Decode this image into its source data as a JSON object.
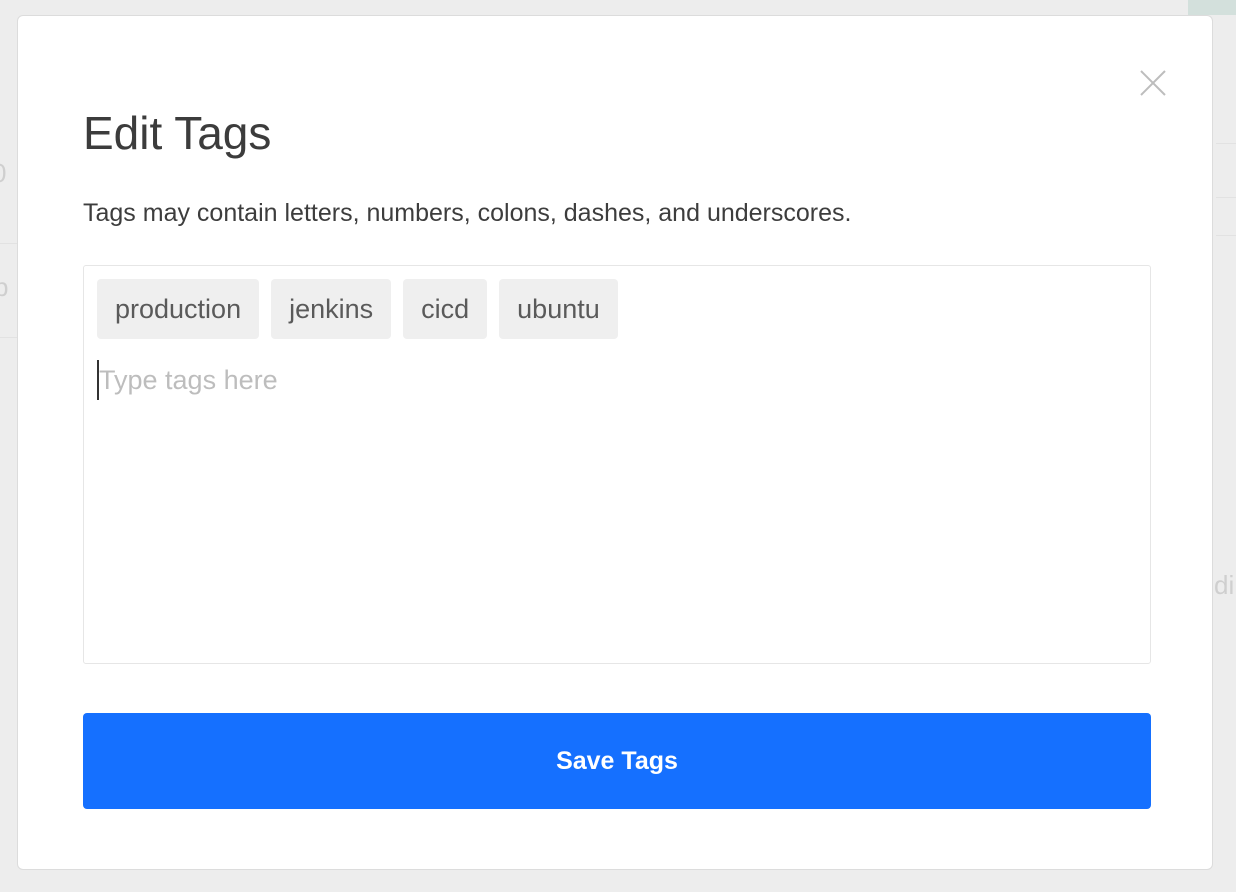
{
  "background": {
    "fragments": [
      "0",
      "p",
      "di"
    ]
  },
  "modal": {
    "title": "Edit Tags",
    "description": "Tags may contain letters, numbers, colons, dashes, and underscores.",
    "tags": [
      "production",
      "jenkins",
      "cicd",
      "ubuntu"
    ],
    "input": {
      "value": "",
      "placeholder": "Type tags here"
    },
    "save_label": "Save Tags",
    "close_icon": "close-icon"
  },
  "colors": {
    "primary": "#1570ff",
    "chip_bg": "#efefef"
  }
}
